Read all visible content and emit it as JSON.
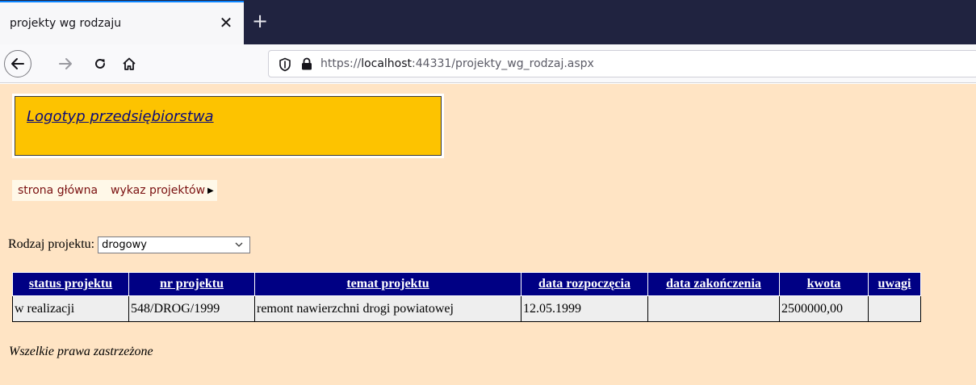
{
  "browser": {
    "tab_title": "projekty wg rodzaju",
    "close_glyph": "✕",
    "new_tab_glyph": "+",
    "url_prefix": "https://",
    "url_host": "localhost",
    "url_rest": ":44331/projekty_wg_rodzaj.aspx"
  },
  "header": {
    "logo_text": "Logotyp przedsiębiorstwa"
  },
  "menu": {
    "items": [
      "strona główna",
      "wykaz projektów"
    ]
  },
  "filter": {
    "label": "Rodzaj projektu:",
    "selected": "drogowy"
  },
  "table": {
    "columns": [
      "status projektu",
      "nr projektu",
      "temat projektu",
      "data rozpoczęcia",
      "data zakończenia",
      "kwota",
      "uwagi"
    ],
    "rows": [
      [
        "w realizacji",
        "548/DROG/1999",
        "remont nawierzchni drogi powiatowej",
        "12.05.1999",
        "",
        "2500000,00",
        ""
      ]
    ]
  },
  "footer": {
    "text": "Wszelkie prawa zastrzeżone"
  },
  "colors": {
    "page_bg": "#ffe4c4",
    "logo_bg": "#fdc300",
    "header_bg": "#000084",
    "cell_bg": "#eeeeee",
    "menu_text": "#7a1010"
  }
}
